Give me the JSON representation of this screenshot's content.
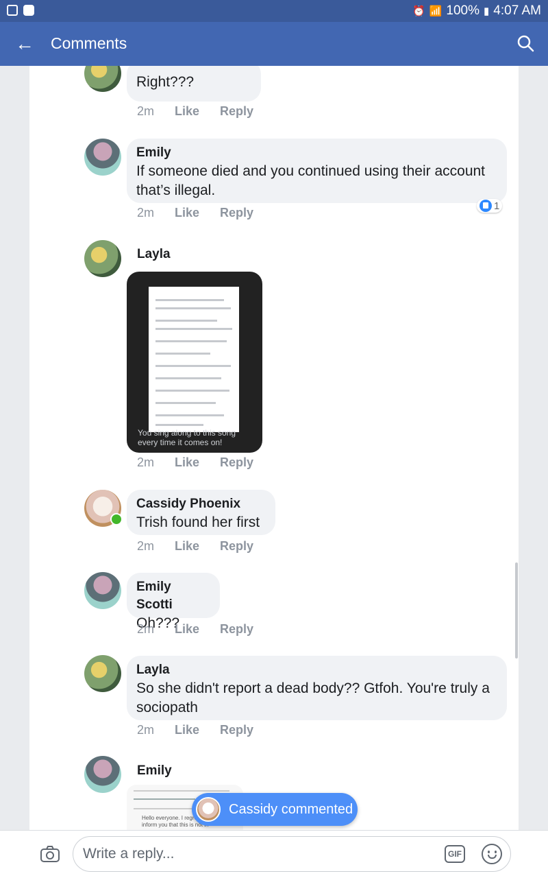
{
  "status_bar": {
    "battery": "100%",
    "time": "4:07 AM"
  },
  "header": {
    "title": "Comments"
  },
  "comments": [
    {
      "author": "",
      "text": "Right???",
      "time": "2m",
      "like": "Like",
      "reply": "Reply"
    },
    {
      "author": "Emily",
      "text": "If someone died and you continued using their account that’s illegal.",
      "time": "2m",
      "like": "Like",
      "reply": "Reply",
      "reactions": "1"
    },
    {
      "author": "Layla",
      "text": "",
      "time": "2m",
      "like": "Like",
      "reply": "Reply",
      "media_caption": "You sing along to this song every time it comes on!"
    },
    {
      "author": "Cassidy Phoenix",
      "text": "Trish found her first",
      "time": "2m",
      "like": "Like",
      "reply": "Reply"
    },
    {
      "author": "Emily Scotti",
      "text": "Oh???",
      "time": "2m",
      "like": "Like",
      "reply": "Reply"
    },
    {
      "author": "Layla",
      "text": "So she didn't report a dead body?? Gtfoh. You're truly a sociopath",
      "time": "2m",
      "like": "Like",
      "reply": "Reply"
    },
    {
      "author": "Emily",
      "text": "",
      "media_text": "Hello everyone. I regret to inform you that this is not in"
    }
  ],
  "toast": {
    "text": "Cassidy commented"
  },
  "reply_bar": {
    "placeholder": "Write a reply...",
    "gif_label": "GIF"
  },
  "colors": {
    "header_bg": "#4267b2",
    "status_bg": "#3a5a9a",
    "bubble": "#f0f2f5",
    "toast": "#4d8ff8",
    "like_blue": "#2d88ff",
    "online": "#42b72a"
  },
  "icons": {
    "back": "back-arrow-icon",
    "search": "search-icon",
    "camera": "camera-icon",
    "gif": "gif-icon",
    "emoji": "smile-icon"
  }
}
